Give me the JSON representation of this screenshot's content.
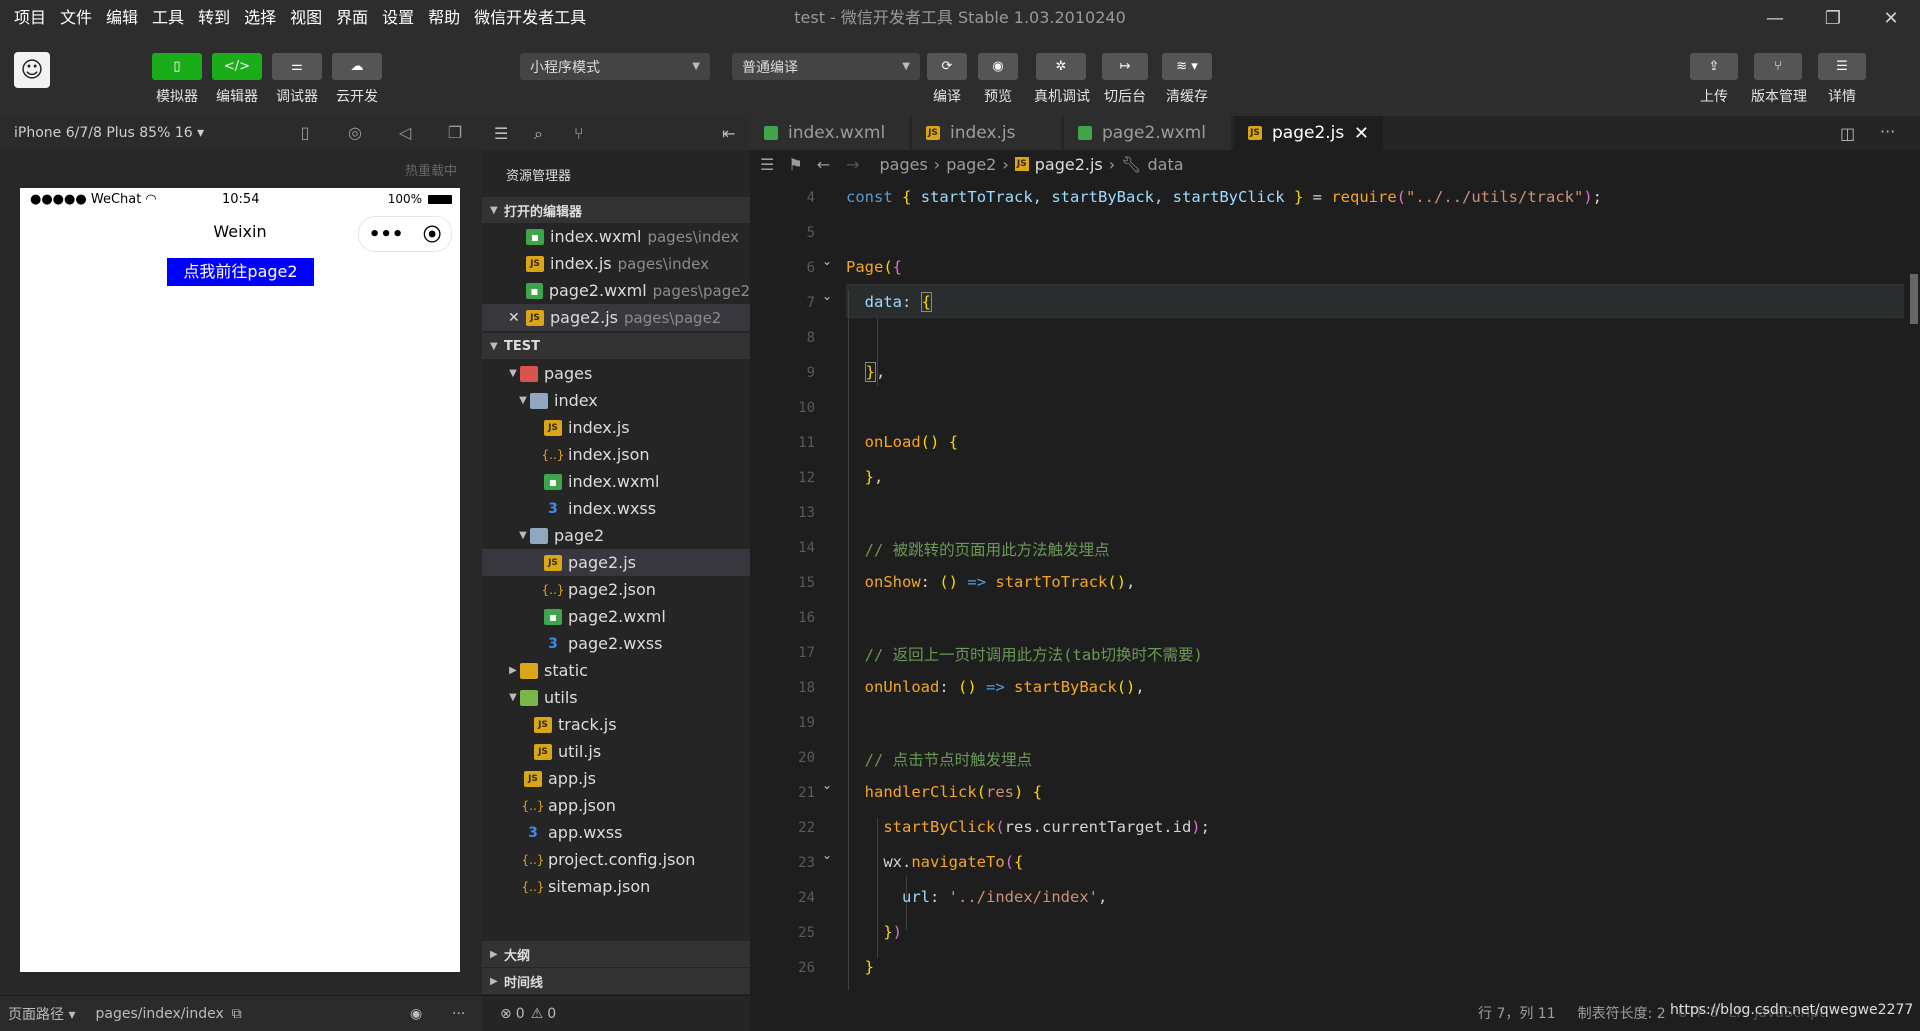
{
  "window": {
    "title": "test - 微信开发者工具 Stable 1.03.2010240",
    "controls": [
      "—",
      "❐",
      "✕"
    ]
  },
  "menu": [
    "项目",
    "文件",
    "编辑",
    "工具",
    "转到",
    "选择",
    "视图",
    "界面",
    "设置",
    "帮助",
    "微信开发者工具"
  ],
  "toolbar": {
    "simulator": "模拟器",
    "editor": "编辑器",
    "debugger": "调试器",
    "cloud": "云开发",
    "mode": "小程序模式",
    "compile_mode": "普通编译",
    "compile": "编译",
    "preview": "预览",
    "real_debug": "真机调试",
    "background": "切后台",
    "clear_cache": "清缓存",
    "upload": "上传",
    "version": "版本管理",
    "details": "详情"
  },
  "simulator": {
    "device": "iPhone 6/7/8 Plus 85% 16 ▾",
    "hot_reload": "热重载中",
    "carrier": "●●●●● WeChat",
    "time": "10:54",
    "battery": "100%",
    "nav_title": "Weixin",
    "page_button": "点我前往page2",
    "footer_label": "页面路径 ▾",
    "footer_path": "pages/index/index"
  },
  "explorer": {
    "title": "资源管理器",
    "open_editors_label": "打开的编辑器",
    "open_editors": [
      {
        "name": "index.wxml",
        "path": "pages\\index"
      },
      {
        "name": "index.js",
        "path": "pages\\index"
      },
      {
        "name": "page2.wxml",
        "path": "pages\\page2"
      },
      {
        "name": "page2.js",
        "path": "pages\\page2"
      }
    ],
    "project_label": "TEST",
    "tree": [
      "pages",
      "index",
      "index.js",
      "index.json",
      "index.wxml",
      "index.wxss",
      "page2",
      "page2.js",
      "page2.json",
      "page2.wxml",
      "page2.wxss",
      "static",
      "utils",
      "track.js",
      "util.js",
      "app.js",
      "app.json",
      "app.wxss",
      "project.config.json",
      "sitemap.json"
    ],
    "outline_label": "大纲",
    "timeline_label": "时间线",
    "errors": "0",
    "warnings": "0"
  },
  "tabs": [
    {
      "label": "index.wxml"
    },
    {
      "label": "index.js"
    },
    {
      "label": "page2.wxml"
    },
    {
      "label": "page2.js"
    }
  ],
  "breadcrumb": [
    "pages",
    "page2",
    "page2.js",
    "data"
  ],
  "code": {
    "line_numbers": [
      "4",
      "5",
      "6",
      "7",
      "8",
      "9",
      "10",
      "11",
      "12",
      "13",
      "14",
      "15",
      "16",
      "17",
      "18",
      "19",
      "20",
      "21",
      "22",
      "23",
      "24",
      "25",
      "26"
    ],
    "l4_const": "const",
    "l4_vars": "startToTrack, startByBack, startByClick",
    "l4_require": "require",
    "l4_path": "\"../../utils/track\"",
    "page": "Page",
    "data": "data",
    "onLoad": "onLoad",
    "c14": "// 被跳转的页面用此方法触发埋点",
    "onShow": "onShow",
    "startToTrack": "startToTrack",
    "c17": "// 返回上一页时调用此方法(tab切换时不需要)",
    "onUnload": "onUnload",
    "startByBack": "startByBack",
    "c20": "// 点击节点时触发埋点",
    "handlerClick": "handlerClick",
    "res": "res",
    "startByClick": "startByClick",
    "currentTarget": "res.currentTarget.id",
    "wx": "wx",
    "navigateTo": "navigateTo",
    "url_key": "url",
    "url_val": "'../index/index'"
  },
  "status": {
    "position": "行 7，列 11",
    "tab_size": "制表符长度: 2",
    "encoding": "UTF-8",
    "eol": "LF",
    "language": "JavaScript",
    "watermark": "https://blog.csdn.net/qwegwe2277"
  }
}
